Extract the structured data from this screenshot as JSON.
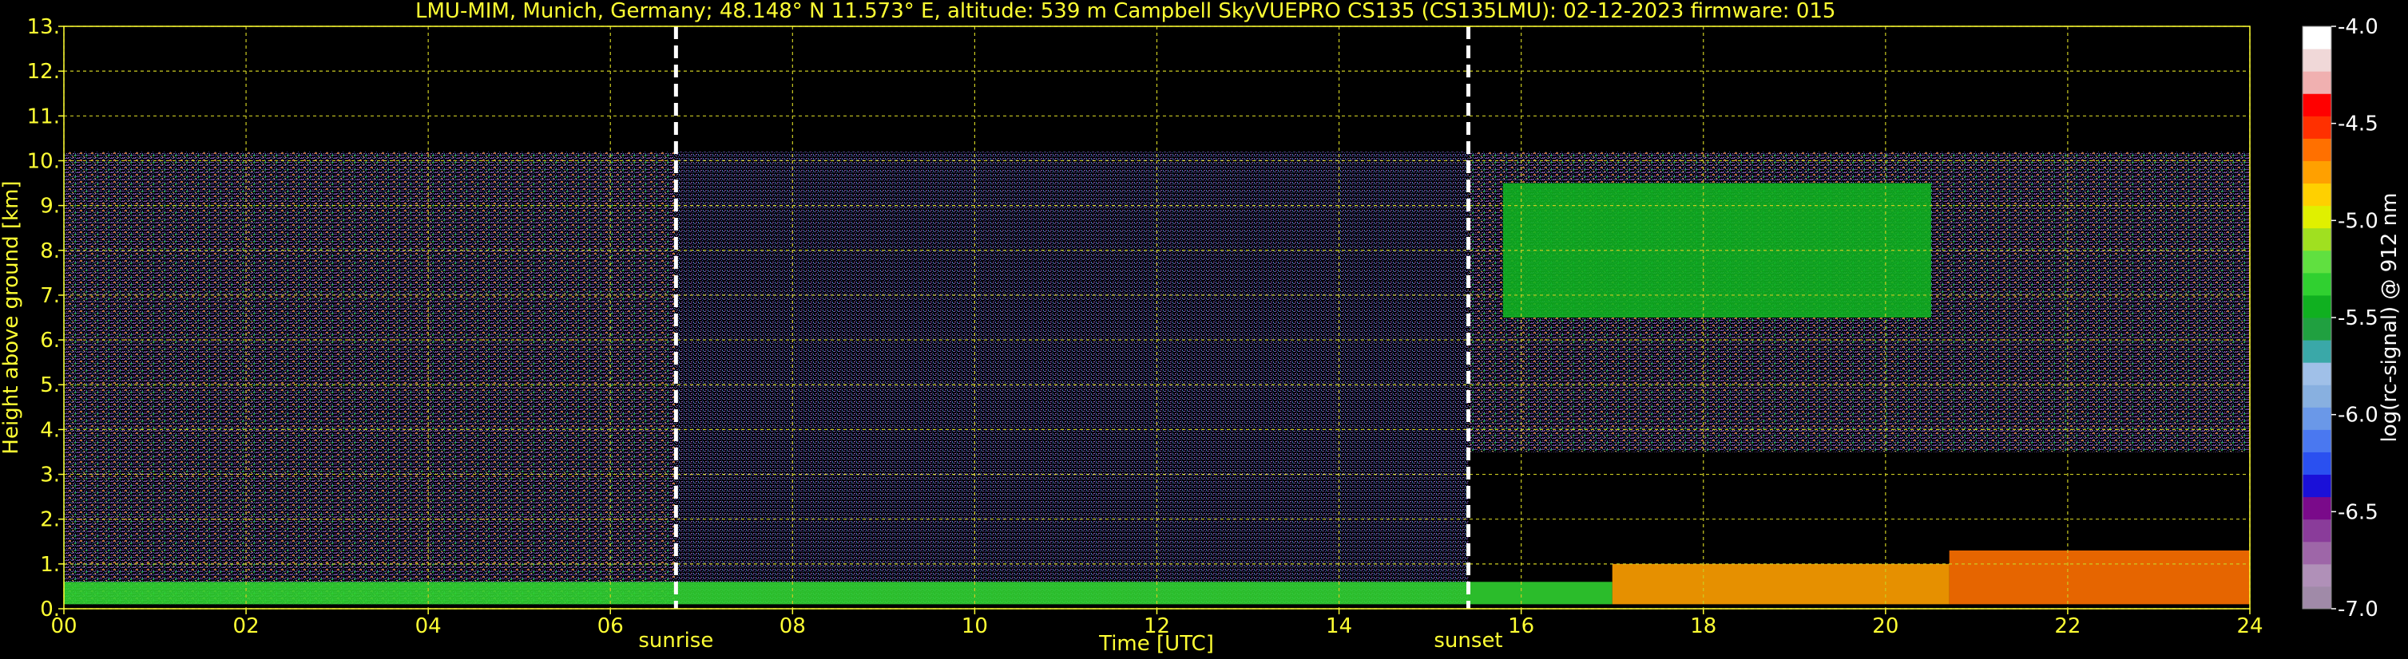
{
  "chart_data": {
    "type": "heatmap",
    "title": "LMU-MIM, Munich, Germany; 48.148° N 11.573° E, altitude: 539 m    Campbell SkyVUEPRO CS135 (CS135LMU): 02-12-2023    firmware: 015",
    "xlabel": "Time [UTC]",
    "ylabel": "Height above ground [km]",
    "xlim": [
      0,
      24
    ],
    "ylim": [
      0,
      13
    ],
    "x_ticks": [
      "00",
      "02",
      "04",
      "06",
      "08",
      "10",
      "12",
      "14",
      "16",
      "18",
      "20",
      "22",
      "24"
    ],
    "y_ticks": [
      "0.",
      "1.",
      "2.",
      "3.",
      "4.",
      "5.",
      "6.",
      "7.",
      "8.",
      "9.",
      "10.",
      "11.",
      "12.",
      "13."
    ],
    "grid": true,
    "markers": [
      {
        "label": "sunrise",
        "x": 6.72
      },
      {
        "label": "sunset",
        "x": 15.42
      }
    ],
    "colorbar": {
      "label": "log(rc-signal) @ 912 nm",
      "range": [
        -7.0,
        -4.0
      ],
      "ticks": [
        "-4.0",
        "-4.5",
        "-5.0",
        "-5.5",
        "-6.0",
        "-6.5",
        "-7.0"
      ],
      "colors": [
        "#a08aa8",
        "#b090b8",
        "#9e66a8",
        "#8a3c9a",
        "#7a0a8a",
        "#1a10d8",
        "#2a50f0",
        "#4a78f0",
        "#6a98e8",
        "#88b0e0",
        "#a0c0e8",
        "#3aa8a8",
        "#20a040",
        "#10b020",
        "#30d030",
        "#60e040",
        "#a0e020",
        "#e0f000",
        "#ffd000",
        "#ffa000",
        "#ff7000",
        "#ff3000",
        "#ff0000",
        "#f0b0b0",
        "#f0d8d8",
        "#ffffff"
      ]
    },
    "regions": [
      {
        "x": [
          0,
          6.72
        ],
        "y": [
          0.1,
          10.2
        ],
        "level": -6.3
      },
      {
        "x": [
          6.72,
          15.42
        ],
        "y": [
          0.1,
          10.2
        ],
        "level": -6.4
      },
      {
        "x": [
          15.42,
          24
        ],
        "y": [
          3.5,
          10.2
        ],
        "level": -6.1
      },
      {
        "x": [
          0,
          17
        ],
        "y": [
          0.1,
          0.6
        ],
        "level": -5.3
      },
      {
        "x": [
          17,
          20.7
        ],
        "y": [
          0.1,
          1.0
        ],
        "level": -4.7
      },
      {
        "x": [
          20.7,
          24
        ],
        "y": [
          0.1,
          1.3
        ],
        "level": -4.6
      },
      {
        "x": [
          15.8,
          20.5
        ],
        "y": [
          6.5,
          9.5
        ],
        "level": -5.4
      }
    ]
  }
}
